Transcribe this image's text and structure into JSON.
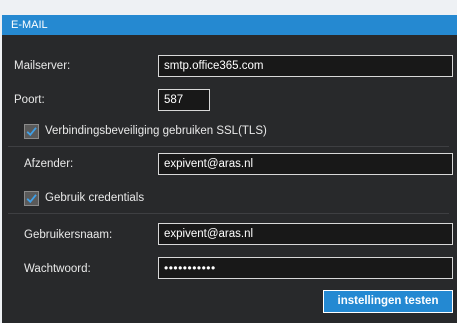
{
  "panel": {
    "title": "E-MAIL"
  },
  "form": {
    "mailserver": {
      "label": "Mailserver:",
      "value": "smtp.office365.com"
    },
    "port": {
      "label": "Poort:",
      "value": "587"
    },
    "ssl": {
      "label": "Verbindingsbeveiliging gebruiken SSL(TLS)",
      "checked": true
    },
    "sender": {
      "label": "Afzender:",
      "value": "expivent@aras.nl"
    },
    "credentials": {
      "label": "Gebruik credentials",
      "checked": true
    },
    "username": {
      "label": "Gebruikersnaam:",
      "value": "expivent@aras.nl"
    },
    "password": {
      "label": "Wachtwoord:",
      "value": "•••••••••••"
    }
  },
  "actions": {
    "test_label": "instellingen testen"
  },
  "colors": {
    "accent": "#2589d1",
    "panel_bg": "#28292b",
    "checkmark": "#3fa0e8"
  },
  "icons": {
    "checkbox": "checkmark-icon"
  }
}
